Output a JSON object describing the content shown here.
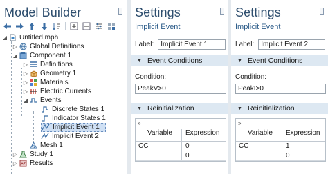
{
  "model_builder": {
    "title": "Model Builder",
    "toolbar": [
      "back-arrow-icon",
      "forward-arrow-icon",
      "up-arrow-icon",
      "down-arrow-icon",
      "sort-icon",
      "expand-all-icon",
      "collapse-all-icon",
      "settings-icon",
      "grid-icon"
    ],
    "tree": [
      {
        "label": "Untitled.mph",
        "icon": "file-icon"
      },
      {
        "label": "Global Definitions",
        "icon": "globe-icon"
      },
      {
        "label": "Component 1",
        "icon": "component-icon"
      },
      {
        "label": "Definitions",
        "icon": "list-icon"
      },
      {
        "label": "Geometry 1",
        "icon": "geometry-icon"
      },
      {
        "label": "Materials",
        "icon": "materials-icon"
      },
      {
        "label": "Electric Currents",
        "icon": "electric-currents-icon"
      },
      {
        "label": "Events",
        "icon": "events-icon"
      },
      {
        "label": "Discrete States 1",
        "icon": "discrete-states-icon"
      },
      {
        "label": "Indicator States 1",
        "icon": "indicator-states-icon"
      },
      {
        "label": "Implicit Event 1",
        "icon": "implicit-event-icon"
      },
      {
        "label": "Implicit Event 2",
        "icon": "implicit-event-icon"
      },
      {
        "label": "Mesh 1",
        "icon": "mesh-icon"
      },
      {
        "label": "Study 1",
        "icon": "study-icon"
      },
      {
        "label": "Results",
        "icon": "results-icon"
      }
    ]
  },
  "settings_1": {
    "title": "Settings",
    "subtitle": "Implicit Event",
    "label_caption": "Label:",
    "label_value": "Implicit Event 1",
    "section_events": "Event Conditions",
    "condition_caption": "Condition:",
    "condition_value": "PeakV>0",
    "section_reinit": "Reinitialization",
    "table": {
      "col_variable": "Variable",
      "col_expression": "Expression",
      "rows": [
        {
          "variable": "CC",
          "expression": "0"
        },
        {
          "variable": "",
          "expression": "0"
        }
      ]
    }
  },
  "settings_2": {
    "title": "Settings",
    "subtitle": "Implicit Event",
    "label_caption": "Label:",
    "label_value": "Implicit Event 2",
    "section_events": "Event Conditions",
    "condition_caption": "Condition:",
    "condition_value": "PeakI>0",
    "section_reinit": "Reinitialization",
    "table": {
      "col_variable": "Variable",
      "col_expression": "Expression",
      "rows": [
        {
          "variable": "CC",
          "expression": "1"
        },
        {
          "variable": "",
          "expression": "0"
        }
      ]
    }
  },
  "colors": {
    "title": "#2e4e6e",
    "section_bg": "#dde8f2",
    "selection_bg": "#cfe0f4",
    "divider": "#e4e9ee"
  },
  "expand_glyph": "»"
}
